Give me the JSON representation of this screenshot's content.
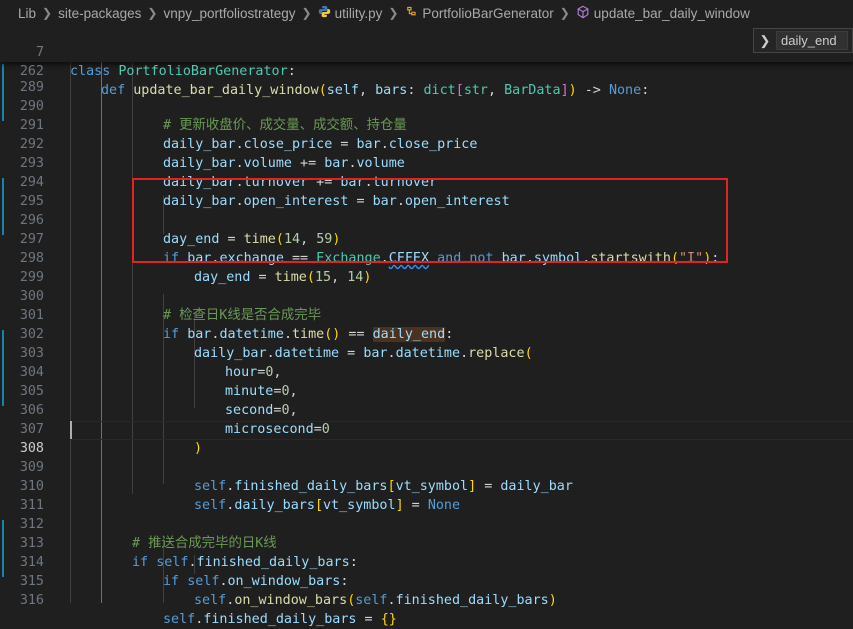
{
  "breadcrumb": {
    "items": [
      "Lib",
      "site-packages",
      "vnpy_portfoliostrategy",
      "utility.py",
      "PortfolioBarGenerator",
      "update_bar_daily_window"
    ],
    "py_icon_glyph": "❯",
    "class_icon_glyph": "⚙",
    "method_icon_glyph": "⬡"
  },
  "find": {
    "value": "daily_end",
    "chevron": "❯"
  },
  "lines": {
    "7": "7",
    "262": "262",
    "289": "289",
    "290": "290",
    "291": "291",
    "292": "292",
    "293": "293",
    "294": "294",
    "295": "295",
    "296": "296",
    "297": "297",
    "298": "298",
    "299": "299",
    "300": "300",
    "301": "301",
    "302": "302",
    "303": "303",
    "304": "304",
    "305": "305",
    "306": "306",
    "307": "307",
    "308": "308",
    "309": "309",
    "310": "310",
    "311": "311",
    "312": "312",
    "313": "313",
    "314": "314",
    "315": "315",
    "316": "316"
  },
  "tok": {
    "class": "class",
    "PortfolioBarGenerator": "PortfolioBarGenerator",
    "colon": ":",
    "def": "def",
    "update_bar_daily_window": "update_bar_daily_window",
    "lparen": "(",
    "rparen": ")",
    "self": "self",
    "comma_sp": ", ",
    "bars": "bars",
    "colon_sp": ": ",
    "dict": "dict",
    "lbrack": "[",
    "rbrack": "]",
    "str": "str",
    "BarData": "BarData",
    "arrow": " -> ",
    "None": "None",
    "cmt_update": "# 更新收盘价、成交量、成交额、持仓量",
    "daily_bar": "daily_bar",
    "dot": ".",
    "close_price": "close_price",
    "eq": " = ",
    "bar": "bar",
    "volume": "volume",
    "pluseq": " += ",
    "turnover": "turnover",
    "open_interest": "open_interest",
    "day_end": "day_end",
    "time": "time",
    "n14": "14",
    "n59": "59",
    "n15": "15",
    "n14b": "14",
    "if": "if",
    "exchange": "exchange",
    "eqeq": " == ",
    "Exchange": "Exchange",
    "CFFEX": "CFFEX",
    "and": "and",
    "not": "not",
    "symbol": "symbol",
    "startswith": "startswith",
    "I": "\"I\"",
    "cmt_check": "# 检查日K线是否合成完毕",
    "datetime": "datetime",
    "empty_parens": "()",
    "daily_end": "daily_end",
    "replace": "replace",
    "hour": "hour",
    "minute": "minute",
    "second": "second",
    "microsecond": "microsecond",
    "eq0": "=",
    "zero": "0",
    "comma": ",",
    "finished_daily_bars": "finished_daily_bars",
    "vt_symbol": "vt_symbol",
    "daily_bars": "daily_bars",
    "cmt_push": "# 推送合成完毕的日K线",
    "on_window_bars": "on_window_bars",
    "lbrace_rbrace": "{}"
  }
}
